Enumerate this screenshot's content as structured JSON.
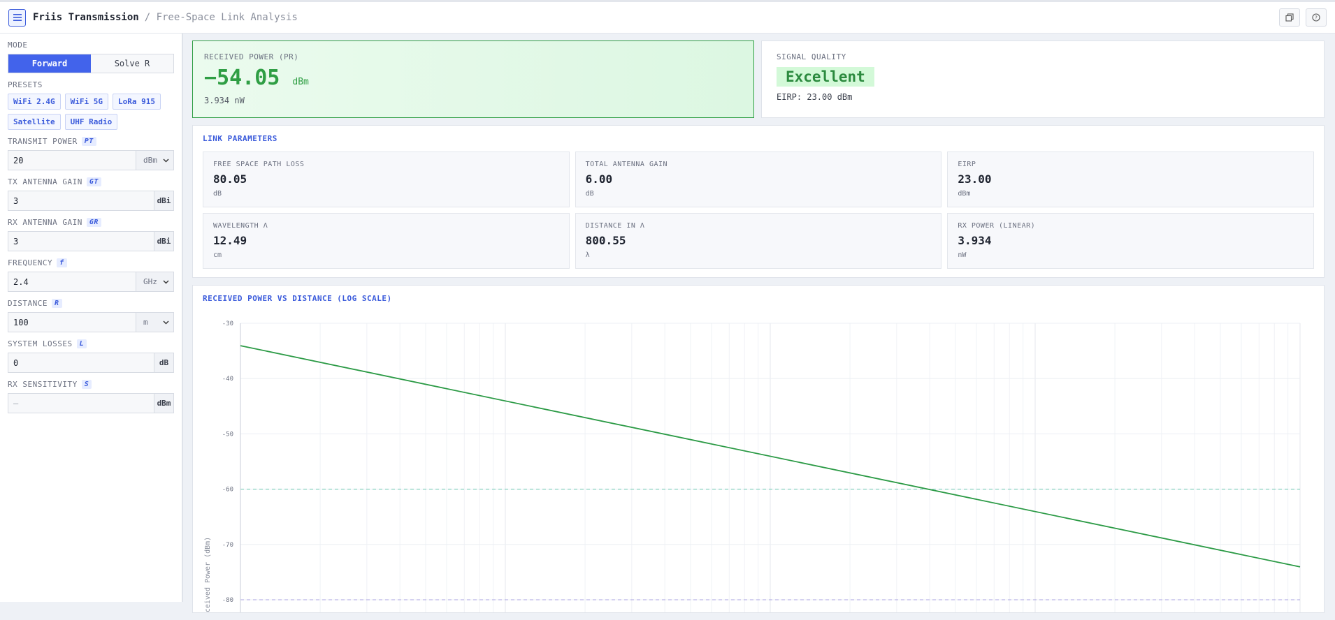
{
  "header": {
    "title": "Friis Transmission",
    "subtitle": "/ Free-Space Link Analysis"
  },
  "sidebar": {
    "mode_label": "MODE",
    "mode_forward": "Forward",
    "mode_solve": "Solve R",
    "presets_label": "PRESETS",
    "presets": [
      "WiFi 2.4G",
      "WiFi 5G",
      "LoRa 915",
      "Satellite",
      "UHF Radio"
    ],
    "fields": [
      {
        "label": "TRANSMIT POWER",
        "sym": "PT",
        "value": "20",
        "unit": "dBm",
        "select": true
      },
      {
        "label": "TX ANTENNA GAIN",
        "sym": "GT",
        "value": "3",
        "unit": "dBi",
        "select": false
      },
      {
        "label": "RX ANTENNA GAIN",
        "sym": "GR",
        "value": "3",
        "unit": "dBi",
        "select": false
      },
      {
        "label": "FREQUENCY",
        "sym": "f",
        "value": "2.4",
        "unit": "GHz",
        "select": true
      },
      {
        "label": "DISTANCE",
        "sym": "R",
        "value": "100",
        "unit": "m",
        "select": true
      },
      {
        "label": "SYSTEM LOSSES",
        "sym": "L",
        "value": "0",
        "unit": "dB",
        "select": false
      },
      {
        "label": "RX SENSITIVITY",
        "sym": "S",
        "value": "",
        "placeholder": "—",
        "unit": "dBm",
        "select": false
      }
    ]
  },
  "result": {
    "label": "RECEIVED POWER (PR)",
    "value": "−54.05",
    "unit": "dBm",
    "linear": "3.934 nW"
  },
  "quality": {
    "label": "SIGNAL QUALITY",
    "value": "Excellent",
    "eirp": "EIRP: 23.00 dBm"
  },
  "link": {
    "title": "LINK PARAMETERS",
    "cells": [
      {
        "label": "FREE SPACE PATH LOSS",
        "value": "80.05",
        "unit": "dB"
      },
      {
        "label": "TOTAL ANTENNA GAIN",
        "value": "6.00",
        "unit": "dB"
      },
      {
        "label": "EIRP",
        "value": "23.00",
        "unit": "dBm"
      },
      {
        "label": "WAVELENGTH Λ",
        "value": "12.49",
        "unit": "cm"
      },
      {
        "label": "DISTANCE IN Λ",
        "value": "800.55",
        "unit": "λ"
      },
      {
        "label": "RX POWER (LINEAR)",
        "value": "3.934",
        "unit": "nW"
      }
    ]
  },
  "colors": {
    "accent": "#4263eb",
    "good": "#2f9e44",
    "line": "#2b9a45",
    "ref_green": "#69c8b0",
    "ref_purple": "#a9a3e0"
  },
  "chart_data": {
    "type": "line",
    "title": "RECEIVED POWER VS DISTANCE (LOG SCALE)",
    "ylabel": "Received Power (dBm)",
    "ylim": [
      -80,
      -30
    ],
    "yticks": [
      "-30",
      "-40",
      "-50",
      "-60",
      "-70",
      "-80"
    ],
    "x_log_scale": true,
    "series": [
      {
        "x": [
          1,
          10000
        ],
        "y": [
          -34.05,
          -74.05
        ]
      }
    ],
    "ref_lines": [
      -60,
      -80
    ],
    "grid": true
  }
}
